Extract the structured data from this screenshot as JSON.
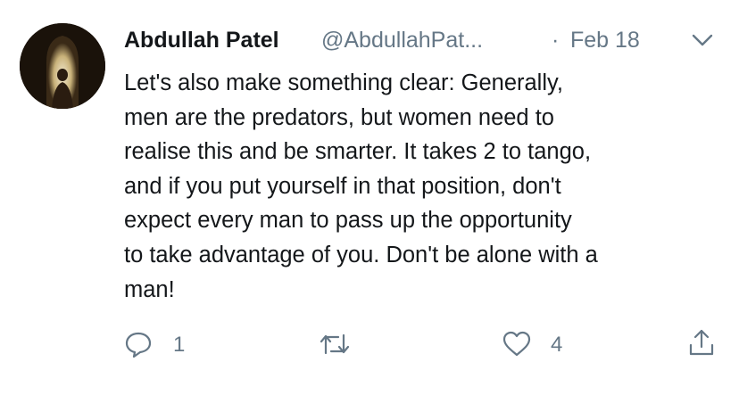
{
  "tweet": {
    "author": {
      "display_name": "Abdullah Patel",
      "handle": "@AbdullahPat...",
      "avatar": "avatar-photo"
    },
    "separator": "·",
    "date": "Feb 18",
    "menu_icon": "chevron-down-icon",
    "text": "Let's also make something clear: Generally,\nmen are the predators, but women need to\nrealise this and be smarter. It takes 2 to tango,\nand if you put yourself in that position, don't\nexpect every man to pass up the opportunity\nto take advantage of you. Don't be alone with a\nman!",
    "actions": {
      "reply": {
        "icon": "reply-icon",
        "count": "1"
      },
      "retweet": {
        "icon": "retweet-icon",
        "count": ""
      },
      "like": {
        "icon": "heart-icon",
        "count": "4"
      },
      "share": {
        "icon": "share-icon"
      }
    }
  },
  "colors": {
    "text_primary": "#14171a",
    "text_secondary": "#657786",
    "background": "#ffffff"
  }
}
